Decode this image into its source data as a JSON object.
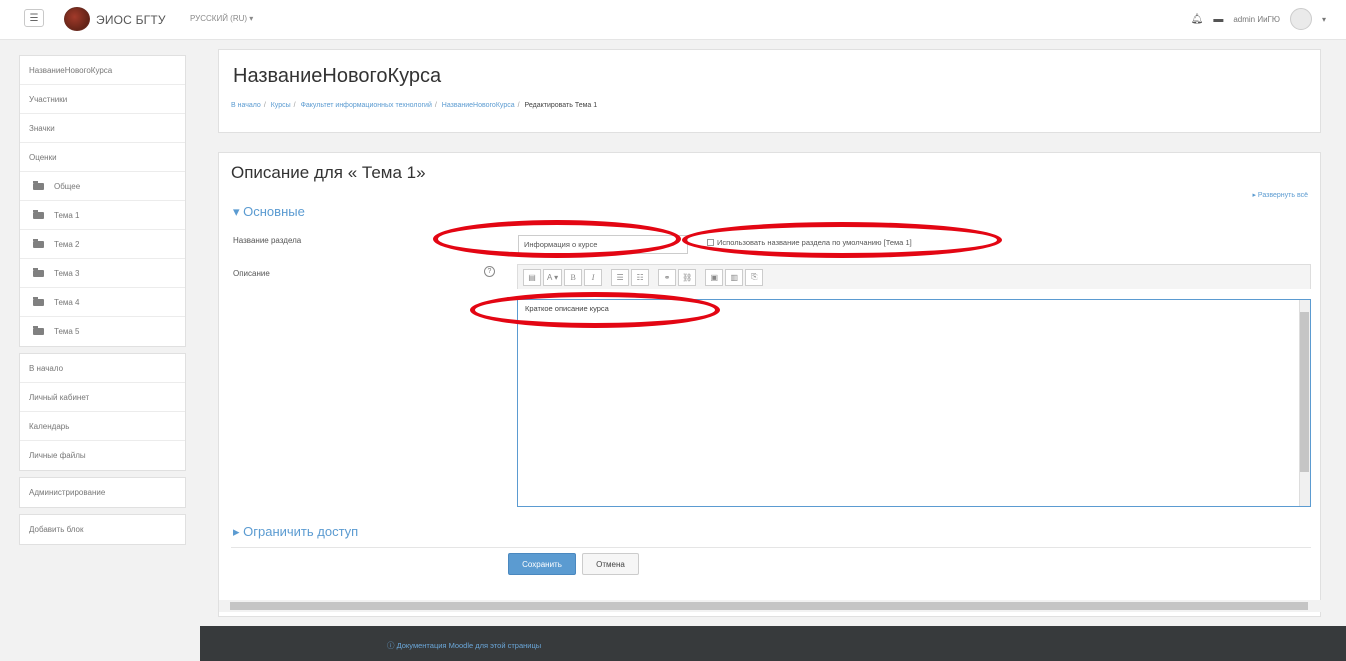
{
  "navbar": {
    "menu_icon": "hamburger-icon",
    "site_name": "ЭИОС БГТУ",
    "language": "РУССКИЙ (RU) ▾",
    "user_name": "admin ИиГЮ",
    "caret": "▾"
  },
  "sidebar": {
    "course_items": [
      {
        "label": "НазваниеНовогоКурса"
      },
      {
        "label": "Участники"
      },
      {
        "label": "Значки"
      },
      {
        "label": "Оценки"
      },
      {
        "label": "Общее"
      },
      {
        "label": "Тема 1"
      },
      {
        "label": "Тема 2"
      },
      {
        "label": "Тема 3"
      },
      {
        "label": "Тема 4"
      },
      {
        "label": "Тема 5"
      }
    ],
    "nav_items": [
      {
        "label": "В начало"
      },
      {
        "label": "Личный кабинет"
      },
      {
        "label": "Календарь"
      },
      {
        "label": "Личные файлы"
      }
    ],
    "admin_label": "Администрирование",
    "add_block_label": "Добавить блок"
  },
  "header": {
    "course_title": "НазваниеНовогоКурса",
    "breadcrumb": [
      {
        "label": "В начало"
      },
      {
        "label": "Курсы"
      },
      {
        "label": "Факультет информационных технологий"
      },
      {
        "label": "НазваниеНовогоКурса"
      },
      {
        "label": "Редактировать Тема 1"
      }
    ]
  },
  "form": {
    "title": "Описание для « Тема 1»",
    "expand_all": "▸ Развернуть всё",
    "section_general": "▾ Основные",
    "section_name_label": "Название раздела",
    "section_name_value": "Информация о курсе",
    "use_default_label": "Использовать название раздела по умолчанию [Тема 1]",
    "use_default_checked": false,
    "description_label": "Описание",
    "help_icon": "?",
    "editor_text": "Краткое описание курса",
    "toolbar": [
      "▤",
      "A ▾",
      "B",
      "I",
      "☰",
      "☷",
      "⚭",
      "⛓",
      "▣",
      "▥",
      "⎘"
    ],
    "restrict_access": "▸ Ограничить доступ",
    "save_label": "Сохранить",
    "cancel_label": "Отмена"
  },
  "footer": {
    "doc_link": "ⓘ Документация Moodle для этой страницы"
  },
  "colors": {
    "accent": "#5b9bd1",
    "annotation": "#e30613",
    "footer_bg": "#373a3c"
  }
}
